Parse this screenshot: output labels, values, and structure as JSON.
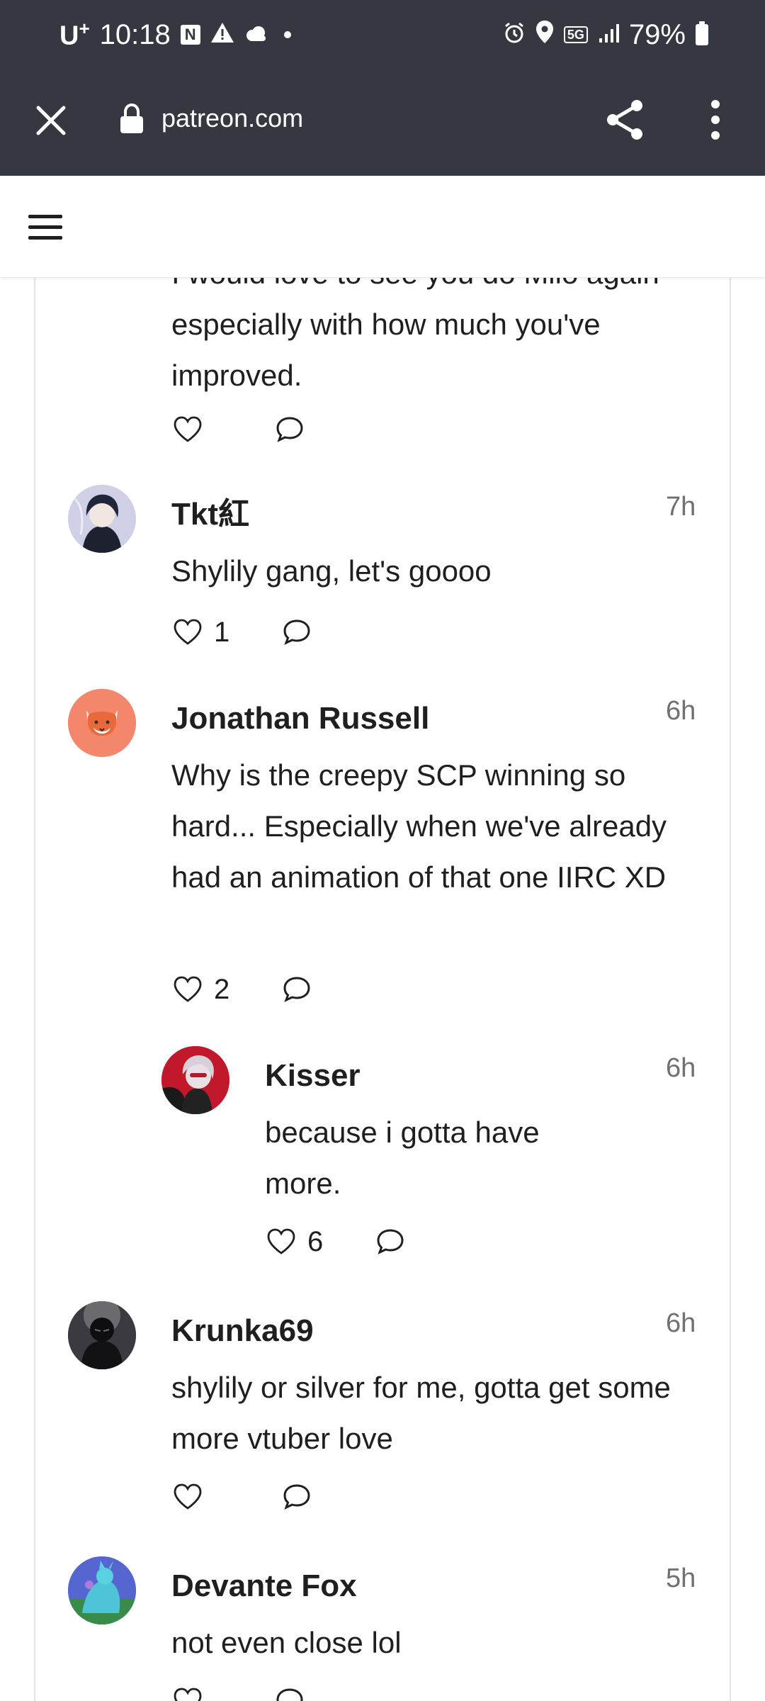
{
  "status_bar": {
    "carrier": "U",
    "carrier_sup": "+",
    "time": "10:18",
    "notification_icon_n": "N",
    "network": "5G",
    "battery": "79%",
    "icons": [
      "warning-icon",
      "cloud-icon",
      "alarm-icon",
      "location-icon",
      "signal-icon",
      "battery-icon"
    ]
  },
  "browser": {
    "url": "patreon.com",
    "icons": [
      "close-icon",
      "lock-icon",
      "share-icon",
      "more-vert-icon"
    ]
  },
  "header": {
    "icons": [
      "hamburger-menu-icon"
    ]
  },
  "cut_comment": {
    "text": "I would love to see you do Milo again especially with how much you've improved."
  },
  "comments": [
    {
      "author": "Tkt紅",
      "time": "7h",
      "text": "Shylily gang, let's goooo",
      "likes": "1"
    },
    {
      "author": "Jonathan Russell",
      "time": "6h",
      "text": "Why is the creepy SCP winning so hard...  Especially when we've already had an animation of that one IIRC XD",
      "likes": "2"
    },
    {
      "author": "Kisser",
      "time": "6h",
      "text": "because i gotta have more.",
      "likes": "6"
    },
    {
      "author": "Krunka69",
      "time": "6h",
      "text": "shylily or silver for me, gotta get some more vtuber love",
      "likes": ""
    },
    {
      "author": "Devante Fox",
      "time": "5h",
      "text": "not even close lol",
      "likes": ""
    }
  ],
  "colors": {
    "chrome_bg": "#353840",
    "text": "#1f1f1f",
    "muted": "#707070",
    "fox_avatar": "#f4866c"
  }
}
